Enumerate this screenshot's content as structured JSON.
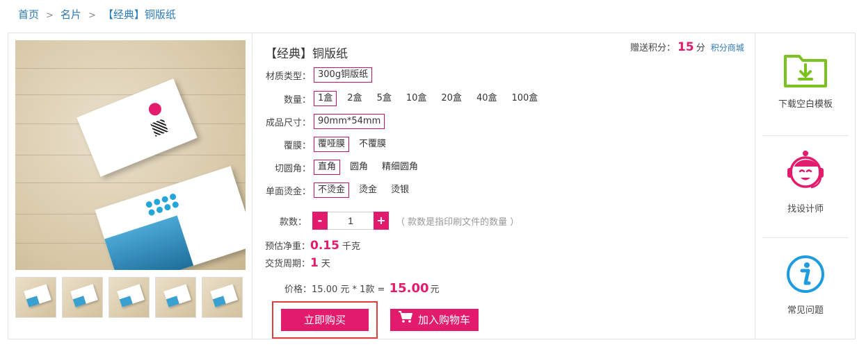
{
  "breadcrumb": {
    "home": "首页",
    "category": "名片",
    "current": "【经典】铜版纸",
    "separator": ">"
  },
  "product": {
    "title": "【经典】铜版纸",
    "points_label": "赠送积分：",
    "points_value": "15",
    "points_unit": "分",
    "points_mall_link": "积分商城"
  },
  "options": {
    "material": {
      "label": "材质类型：",
      "items": [
        "300g铜版纸"
      ],
      "selected": "300g铜版纸"
    },
    "quantity": {
      "label": "数量：",
      "items": [
        "1盒",
        "2盒",
        "5盒",
        "10盒",
        "20盒",
        "40盒",
        "100盒"
      ],
      "selected": "1盒"
    },
    "size": {
      "label": "成品尺寸：",
      "items": [
        "90mm*54mm"
      ],
      "selected": "90mm*54mm"
    },
    "lamination": {
      "label": "覆膜：",
      "items": [
        "覆哑膜",
        "不覆膜"
      ],
      "selected": "覆哑膜"
    },
    "corner": {
      "label": "切圆角：",
      "items": [
        "直角",
        "圆角",
        "精细圆角"
      ],
      "selected": "直角"
    },
    "foil": {
      "label": "单面烫金：",
      "items": [
        "不烫金",
        "烫金",
        "烫银"
      ],
      "selected": "不烫金"
    }
  },
  "styles": {
    "label": "款数：",
    "minus": "-",
    "plus": "+",
    "value": "1",
    "hint": "（ 款数是指印刷文件的数量 ）"
  },
  "weight": {
    "label": "预估净重：",
    "value": "0.15",
    "unit": "千克"
  },
  "delivery": {
    "label": "交货周期：",
    "value": "1",
    "unit": "天"
  },
  "price": {
    "label": "价格：",
    "formula": "15.00 元 * 1款 =",
    "total": "15.00",
    "unit": "元"
  },
  "actions": {
    "buy_now": "立即购买",
    "add_to_cart": "加入购物车"
  },
  "sidebar": {
    "items": [
      {
        "label": "下载空白模板",
        "icon": "folder-download-icon"
      },
      {
        "label": "找设计师",
        "icon": "designer-headset-icon"
      },
      {
        "label": "常见问题",
        "icon": "info-icon"
      }
    ]
  },
  "colors": {
    "accent": "#e31b6d",
    "link": "#2a7ab8",
    "green": "#7cc21f",
    "blue": "#1f9be0"
  },
  "gallery": {
    "thumbnail_count": 5
  }
}
